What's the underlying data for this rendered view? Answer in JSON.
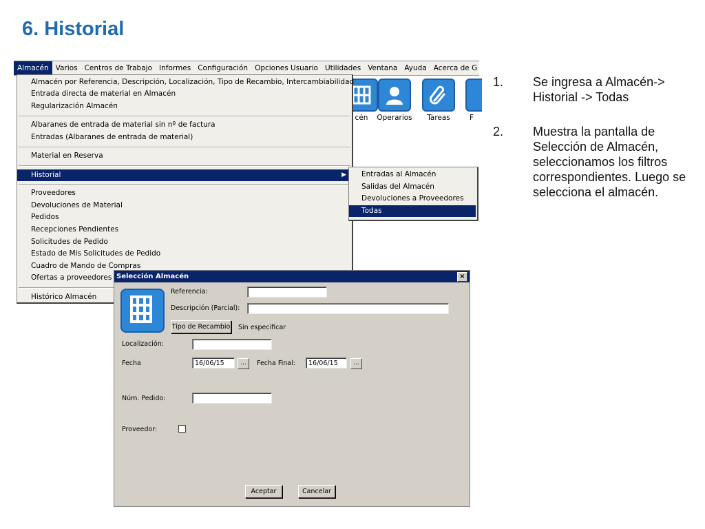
{
  "slide": {
    "title": "6. Historial",
    "steps": [
      {
        "num": "1.",
        "text": "Se ingresa a Almacén-> Historial -> Todas"
      },
      {
        "num": "2.",
        "text": "Muestra la pantalla de Selección de Almacén, seleccionamos los filtros correspondientes. Luego se selecciona el almacén."
      }
    ]
  },
  "menubar": {
    "items": [
      "Almacén",
      "Varios",
      "Centros de Trabajo",
      "Informes",
      "Configuración",
      "Opciones Usuario",
      "Utilidades",
      "Ventana",
      "Ayuda",
      "Acerca de G"
    ]
  },
  "toolbar": {
    "buttons": [
      {
        "label": "cén",
        "icon": "almacen-icon"
      },
      {
        "label": "Operarios",
        "icon": "user-icon"
      },
      {
        "label": "Tareas",
        "icon": "paperclip-icon"
      },
      {
        "label": "F",
        "icon": "document-icon"
      }
    ]
  },
  "dropdown": {
    "items": [
      "Almacén por Referencia, Descripción, Localización, Tipo de Recambio, Intercambiabilidad",
      "Entrada directa de material en Almacén",
      "Regularización Almacén",
      "Albaranes de entrada de material sin nº de factura",
      "Entradas (Albaranes de entrada de material)",
      "Material en Reserva",
      "Historial",
      "Proveedores",
      "Devoluciones de Material",
      "Pedidos",
      "Recepciones Pendientes",
      "Solicitudes de Pedido",
      "Estado de Mis Solicitudes de Pedido",
      "Cuadro de Mando de Compras",
      "Ofertas a proveedores",
      "Histórico Almacén"
    ],
    "selected": "Historial"
  },
  "submenu": {
    "items": [
      "Entradas al Almacén",
      "Salidas del Almacén",
      "Devoluciones a Proveedores",
      "Todas"
    ],
    "selected": "Todas"
  },
  "dialog": {
    "title": "Selección Almacén",
    "close": "×",
    "referencia_label": "Referencia:",
    "referencia_value": "",
    "descripcion_label": "Descripción (Parcial):",
    "descripcion_value": "",
    "tipo_button": "Tipo de Recambio",
    "tipo_value": "Sin especificar",
    "localizacion_label": "Localización:",
    "localizacion_value": "",
    "fecha_label": "Fecha",
    "fecha_value": "16/06/15",
    "fecha_final_label": "Fecha Final:",
    "fecha_final_value": "16/06/15",
    "ellipsis": "...",
    "num_pedido_label": "Núm. Pedido:",
    "num_pedido_value": "",
    "proveedor_label": "Proveedor:",
    "proveedor_checked": false,
    "aceptar": "Aceptar",
    "cancelar": "Cancelar"
  }
}
